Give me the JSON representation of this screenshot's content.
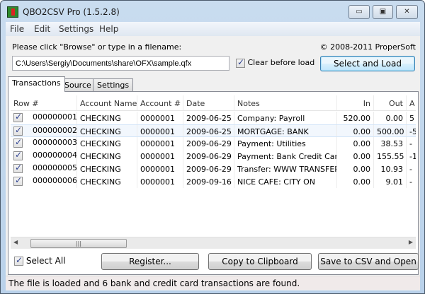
{
  "window": {
    "title": "QBO2CSV Pro (1.5.2.8)",
    "controls": {
      "minimize": "▭",
      "maximize": "▣",
      "close": "✕"
    }
  },
  "menu": [
    "File",
    "Edit",
    "Settings",
    "Help"
  ],
  "file_prompt": "Please click \"Browse\" or type in a filename:",
  "copyright": "© 2008-2011 ProperSoft",
  "filename": "C:\\Users\\Sergiy\\Documents\\share\\OFX\\sample.qfx",
  "clear_before_load": {
    "label": "Clear before load",
    "checked": true
  },
  "select_load_label": "Select and Load",
  "tabs": [
    {
      "label": "Transactions",
      "active": true
    },
    {
      "label": "Source"
    },
    {
      "label": "Settings"
    }
  ],
  "table": {
    "columns": [
      "Row #",
      "Account Name",
      "Account #",
      "Date",
      "Notes",
      "In",
      "Out",
      "A"
    ],
    "rows": [
      {
        "checked": true,
        "row": "000000001",
        "account_name": "CHECKING",
        "account": "0000001",
        "date": "2009-06-25",
        "notes": "Company: Payroll",
        "in": "520.00",
        "out": "0.00",
        "amount": "5"
      },
      {
        "checked": true,
        "row": "000000002",
        "account_name": "CHECKING",
        "account": "0000001",
        "date": "2009-06-25",
        "notes": "MORTGAGE: BANK",
        "in": "0.00",
        "out": "500.00",
        "amount": "-5"
      },
      {
        "checked": true,
        "row": "000000003",
        "account_name": "CHECKING",
        "account": "0000001",
        "date": "2009-06-29",
        "notes": "Payment: Utilities",
        "in": "0.00",
        "out": "38.53",
        "amount": "-"
      },
      {
        "checked": true,
        "row": "000000004",
        "account_name": "CHECKING",
        "account": "0000001",
        "date": "2009-06-29",
        "notes": "Payment: Bank Credit Card",
        "in": "0.00",
        "out": "155.55",
        "amount": "-1"
      },
      {
        "checked": true,
        "row": "000000005",
        "account_name": "CHECKING",
        "account": "0000001",
        "date": "2009-06-29",
        "notes": "Transfer: WWW TRANSFER",
        "in": "0.00",
        "out": "10.93",
        "amount": "-"
      },
      {
        "checked": true,
        "row": "000000006",
        "account_name": "CHECKING",
        "account": "0000001",
        "date": "2009-09-16",
        "notes": "NICE CAFE: CITY ON",
        "in": "0.00",
        "out": "9.01",
        "amount": "-"
      }
    ]
  },
  "select_all": {
    "label": "Select All",
    "checked": true
  },
  "buttons": {
    "register": "Register...",
    "copy": "Copy to Clipboard",
    "save": "Save to CSV and Open"
  },
  "status": "The file is loaded and 6 bank and credit card transactions are found."
}
